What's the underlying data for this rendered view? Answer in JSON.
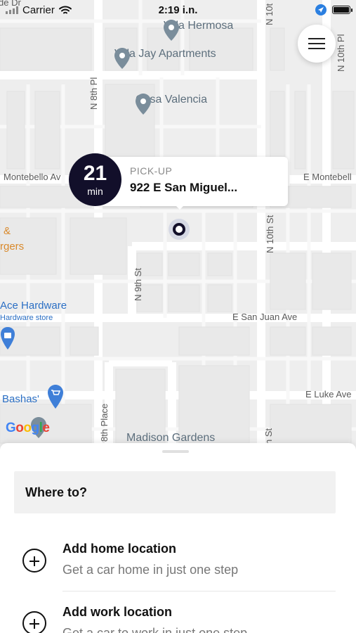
{
  "status_bar": {
    "carrier": "Carrier",
    "time": "2:19 i.n.",
    "top_left_fragment": "de Dr"
  },
  "map": {
    "streets": {
      "n10th_top": "N 10t",
      "n10th_right": "N 10th Pl",
      "n8th_pl": "N 8th Pl",
      "montebello_left": "Montebello Av",
      "montebello_right": "E Montebell",
      "n10th_st": "N 10th St",
      "n9th_st": "N 9th St",
      "san_juan": "E San Juan Ave",
      "luke": "E Luke Ave",
      "place_8th": "8th Place",
      "n_st_bottom": "n St"
    },
    "pois": {
      "villa_hermosa": "Villa Hermosa",
      "villa_jay": "Villa Jay Apartments",
      "casa_valencia": "Casa Valencia",
      "ace_hardware": "Ace Hardware",
      "hardware_store": "Hardware store",
      "bashas": "Bashas'",
      "madison_gardens": "Madison Gardens",
      "burgers_amp": "&",
      "burgers": "rgers"
    },
    "google_logo": "Google"
  },
  "pickup": {
    "eta_value": "21",
    "eta_unit": "min",
    "label": "PICK-UP",
    "address": "922 E San Miguel..."
  },
  "sheet": {
    "where_to": "Where to?",
    "home_title": "Add home location",
    "home_sub": "Get a car home in just one step",
    "work_title": "Add work location",
    "work_sub": "Get a car to work in just one step"
  },
  "colors": {
    "brand_dark": "#120f2a",
    "poi_gray": "#5d6f7d",
    "poi_blue": "#2b6fc4",
    "poi_orange": "#d9892b"
  }
}
